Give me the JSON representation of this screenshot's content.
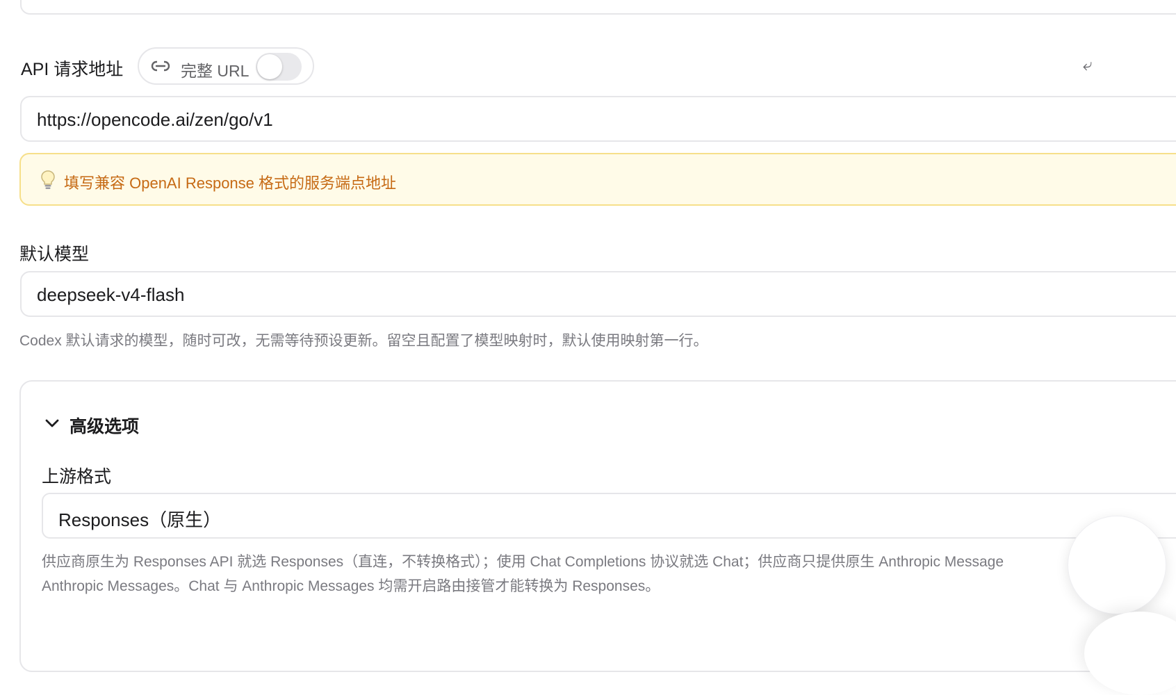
{
  "api_url": {
    "label": "API 请求地址",
    "full_url_toggle_label": "完整 URL",
    "full_url_enabled": false,
    "value": "https://opencode.ai/zen/go/v1",
    "hint": "填写兼容 OpenAI Response 格式的服务端点地址"
  },
  "default_model": {
    "label": "默认模型",
    "value": "deepseek-v4-flash",
    "help": "Codex 默认请求的模型，随时可改，无需等待预设更新。留空且配置了模型映射时，默认使用映射第一行。"
  },
  "advanced": {
    "title": "高级选项",
    "expanded": true,
    "upstream_format": {
      "label": "上游格式",
      "value": "Responses（原生）",
      "help_line1": "供应商原生为 Responses API 就选 Responses（直连，不转换格式）；使用 Chat Completions 协议就选 Chat；供应商只提供原生 Anthropic Message",
      "help_line2": "Anthropic Messages。Chat 与 Anthropic Messages 均需开启路由接管才能转换为 Responses。"
    }
  },
  "colors": {
    "hint_bg": "#fffbe8",
    "hint_border": "#f6df8a",
    "hint_text": "#c66a14",
    "border": "#e6e6e9",
    "help_text": "#7a7a80"
  },
  "icons": {
    "link": "link-icon",
    "bulb": "lightbulb-icon",
    "chevron": "chevron-down-icon"
  }
}
